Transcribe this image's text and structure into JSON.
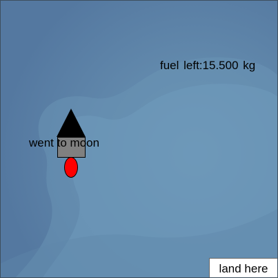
{
  "game": {
    "fuel_text": "fuel left:15.500  kg",
    "status_text": "went to moon"
  },
  "controls": {
    "land_label": "land here"
  },
  "colors": {
    "space_background": "#5b83a8",
    "ship_nose": "#000000",
    "ship_body": "#808080",
    "ship_flame": "#ff0000",
    "button_background": "#ffffff"
  },
  "icons": {
    "ship": "rocket-icon",
    "flame": "thruster-flame-icon"
  }
}
